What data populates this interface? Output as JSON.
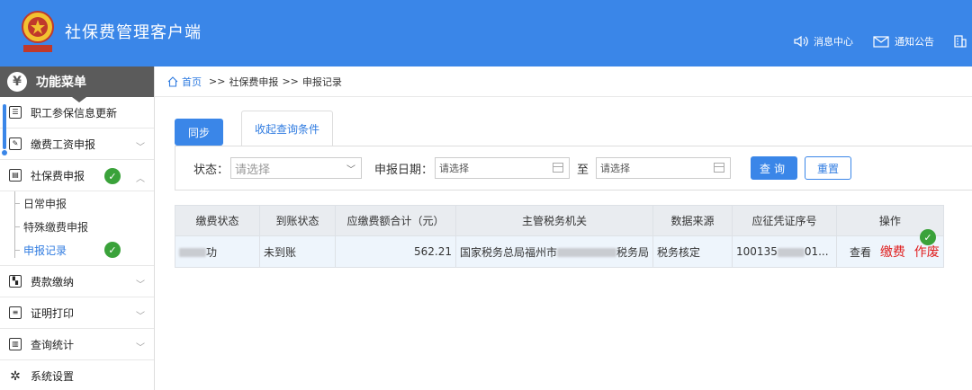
{
  "header": {
    "title": "社保费管理客户端",
    "links": [
      {
        "label": "消息中心",
        "icon": "speaker-icon"
      },
      {
        "label": "通知公告",
        "icon": "mail-icon"
      }
    ]
  },
  "sidebar": {
    "menu_title": "功能菜单",
    "items": [
      {
        "label": "职工参保信息更新",
        "expandable": false
      },
      {
        "label": "缴费工资申报",
        "expandable": true
      },
      {
        "label": "社保费申报",
        "expandable": true,
        "expanded": true
      },
      {
        "label": "费款缴纳",
        "expandable": true
      },
      {
        "label": "证明打印",
        "expandable": true
      },
      {
        "label": "查询统计",
        "expandable": true
      },
      {
        "label": "系统设置",
        "expandable": false
      }
    ],
    "sub_items": [
      "日常申报",
      "特殊缴费申报",
      "申报记录"
    ]
  },
  "breadcrumb": {
    "home": "首页",
    "sep": ">>",
    "level1": "社保费申报",
    "level2": "申报记录"
  },
  "toolbar": {
    "sync_label": "同步",
    "collapse_label": "收起查询条件"
  },
  "filters": {
    "status_label": "状态：",
    "status_placeholder": "请选择",
    "date_label": "申报日期：",
    "date_from": "请选择",
    "date_to_sep": "至",
    "date_to": "请选择",
    "query_label": "查询",
    "reset_label": "重置"
  },
  "table": {
    "headers": [
      "缴费状态",
      "到账状态",
      "应缴费额合计（元）",
      "主管税务机关",
      "数据来源",
      "应征凭证序号",
      "操作"
    ],
    "rows": [
      {
        "pay_status_tail": "功",
        "arrival_status": "未到账",
        "amount": "562.21",
        "tax_office_prefix": "国家税务总局福州市",
        "tax_office_suffix": "税务局",
        "source": "税务核定",
        "voucher_prefix": "100135",
        "voucher_suffix": "01...",
        "ops": {
          "view": "查看",
          "pay": "缴费",
          "void": "作废"
        }
      }
    ]
  },
  "colors": {
    "header_bg": "#3a86e8",
    "menu_head_bg": "#5b5b5b",
    "accent": "#2f7be0",
    "danger": "#e02020",
    "check_green": "#3aa23a"
  }
}
